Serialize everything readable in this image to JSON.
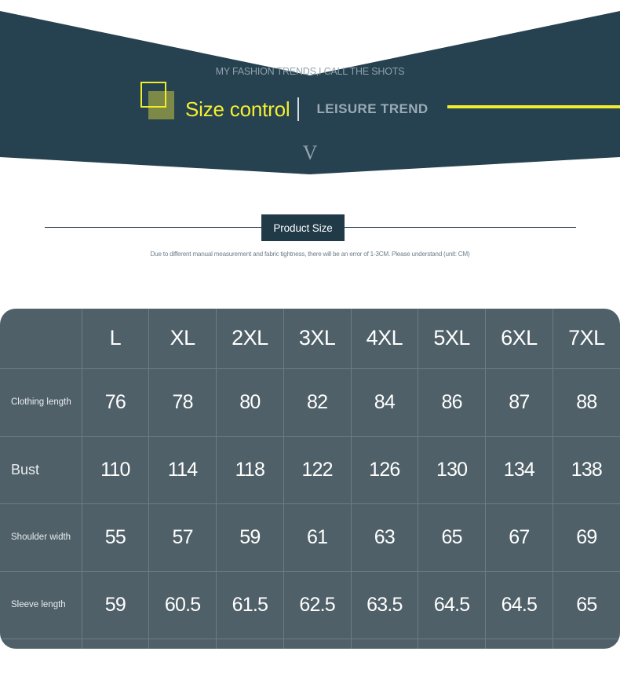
{
  "hero": {
    "tagline": "MY FASHION TRENDS,I CALL THE SHOTS",
    "title": "Size control",
    "subtitle": "LEISURE TREND",
    "chevron_glyph": "V",
    "colors": {
      "banner_bg": "#26414f",
      "accent_yellow": "#f2ec2f",
      "subtitle_grey": "#9aabb5",
      "tagline_grey": "#8fa2ad"
    }
  },
  "section": {
    "badge_label": "Product Size",
    "disclaimer": "Due to different manual measurement and fabric tightness, there will be an error of 1-3CM. Please understand (unit: CM)",
    "badge_bg": "#213a48",
    "rule_color": "#26414f"
  },
  "size_table": {
    "bg": "#4f6068",
    "grid_line": "#6d7d85",
    "corner_label": "",
    "columns": [
      "L",
      "XL",
      "2XL",
      "3XL",
      "4XL",
      "5XL",
      "6XL",
      "7XL"
    ],
    "rows": [
      {
        "label": "Clothing length",
        "values": [
          "76",
          "78",
          "80",
          "82",
          "84",
          "86",
          "87",
          "88"
        ]
      },
      {
        "label": "Bust",
        "values": [
          "110",
          "114",
          "118",
          "122",
          "126",
          "130",
          "134",
          "138"
        ]
      },
      {
        "label": "Shoulder width",
        "values": [
          "55",
          "57",
          "59",
          "61",
          "63",
          "65",
          "67",
          "69"
        ]
      },
      {
        "label": "Sleeve length",
        "values": [
          "59",
          "60.5",
          "61.5",
          "62.5",
          "63.5",
          "64.5",
          "64.5",
          "65"
        ]
      }
    ]
  }
}
